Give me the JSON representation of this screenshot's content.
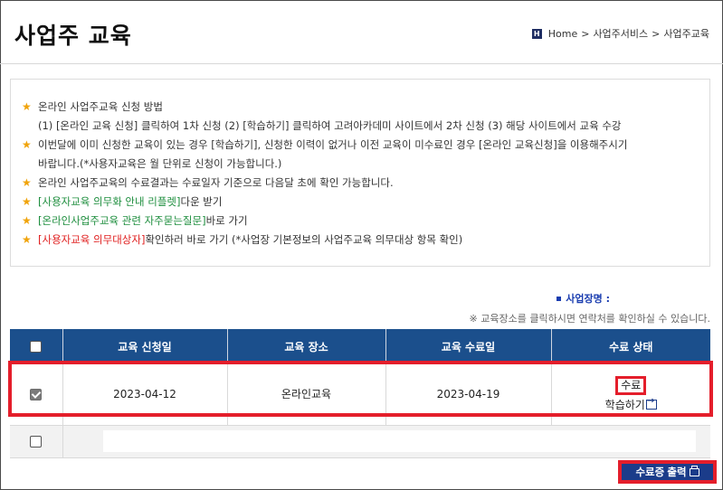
{
  "header": {
    "title": "사업주  교육",
    "breadcrumb": {
      "home_icon_glyph": "H",
      "home": "Home",
      "sep1": ">",
      "level1": "사업주서비스",
      "sep2": ">",
      "level2": "사업주교육"
    }
  },
  "notice": {
    "star_glyph": "★",
    "line1": "온라인 사업주교육 신청 방법",
    "line2": "(1) [온라인 교육 신청] 클릭하여 1차 신청 (2) [학습하기] 클릭하여 고려아카데미 사이트에서 2차 신청 (3) 해당 사이트에서 교육 수강",
    "line3": "이번달에 이미 신청한 교육이 있는 경우 [학습하기], 신청한 이력이 없거나 이전 교육이 미수료인 경우 [온라인 교육신청]을 이용해주시기",
    "line4": "바랍니다.(*사용자교육은 월 단위로 신청이 가능합니다.)",
    "line5": "온라인 사업주교육의 수료결과는 수료일자 기준으로 다음달 초에 확인 가능합니다.",
    "link1_text": "[사용자교육 의무화 안내 리플렛]",
    "link1_suffix": "다운 받기",
    "link2_text": "[온라인사업주교육 관련 자주묻는질문]",
    "link2_suffix": " 바로 가기",
    "link3_text": "[사용자교육 의무대상자]",
    "link3_suffix": " 확인하러 바로 가기 (*사업장 기본정보의 사업주교육 의무대상 항목 확인)"
  },
  "company": {
    "label": "사업장명 :"
  },
  "hint": "※ 교육장소를 클릭하시면 연락처를 확인하실 수 있습니다.",
  "table": {
    "headers": [
      "교육 신청일",
      "교육 장소",
      "교육 수료일",
      "수료 상태"
    ],
    "rows": [
      {
        "checked": true,
        "apply_date": "2023-04-12",
        "place": "온라인교육",
        "complete_date": "2023-04-19",
        "status": "수료",
        "study_link": "학습하기"
      }
    ]
  },
  "buttons": {
    "print_certificate": "수료증 출력"
  },
  "colors": {
    "header_bg": "#1b4f8c",
    "highlight": "#e41e2b",
    "star": "#f0a30a",
    "link_green": "#1e8e3e",
    "link_red": "#e02020",
    "button_bg": "#1b3c8a"
  },
  "icons": {
    "home": "home-icon",
    "star": "star-icon",
    "enter": "enter-icon",
    "printer": "printer-icon"
  }
}
